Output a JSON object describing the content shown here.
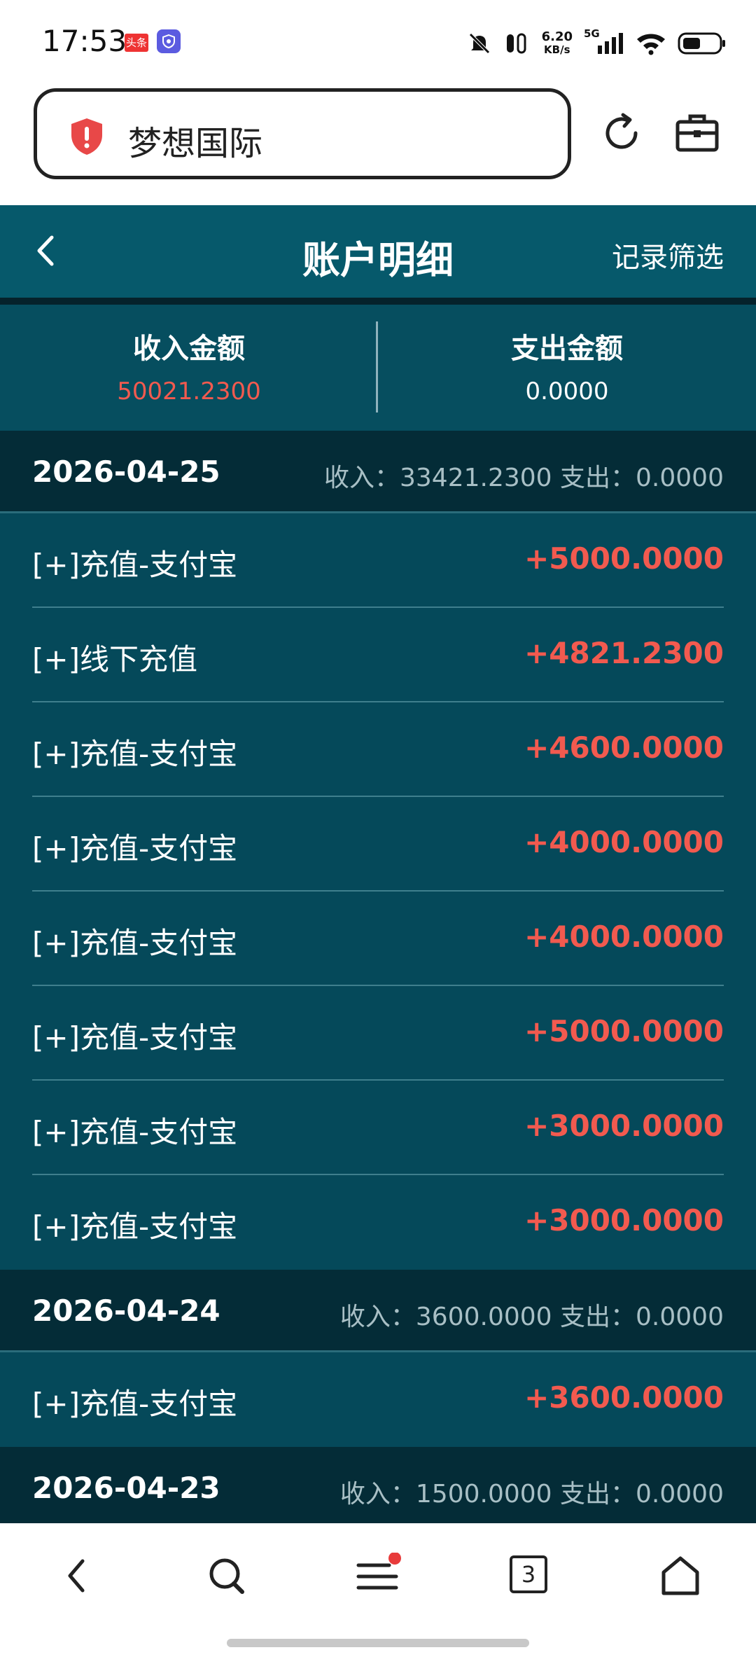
{
  "status_bar": {
    "time": "17:53",
    "badge_text": "头条",
    "net_speed_value": "6.20",
    "net_speed_unit": "KB/s",
    "network": "5G"
  },
  "browser": {
    "site_name": "梦想国际"
  },
  "header": {
    "title": "账户明细",
    "filter_label": "记录筛选"
  },
  "summary": {
    "income_label": "收入金额",
    "income_value": "50021.2300",
    "expense_label": "支出金额",
    "expense_value": "0.0000"
  },
  "days": [
    {
      "date": "2026-04-25",
      "summary": "收入：33421.2300 支出：0.0000",
      "items": [
        {
          "desc": "[+]充值-支付宝",
          "amount": "+5000.0000"
        },
        {
          "desc": "[+]线下充值",
          "amount": "+4821.2300"
        },
        {
          "desc": "[+]充值-支付宝",
          "amount": "+4600.0000"
        },
        {
          "desc": "[+]充值-支付宝",
          "amount": "+4000.0000"
        },
        {
          "desc": "[+]充值-支付宝",
          "amount": "+4000.0000"
        },
        {
          "desc": "[+]充值-支付宝",
          "amount": "+5000.0000"
        },
        {
          "desc": "[+]充值-支付宝",
          "amount": "+3000.0000"
        },
        {
          "desc": "[+]充值-支付宝",
          "amount": "+3000.0000"
        }
      ]
    },
    {
      "date": "2026-04-24",
      "summary": "收入：3600.0000 支出：0.0000",
      "items": [
        {
          "desc": "[+]充值-支付宝",
          "amount": "+3600.0000"
        }
      ]
    },
    {
      "date": "2026-04-23",
      "summary": "收入：1500.0000 支出：0.0000",
      "items": []
    }
  ],
  "nav": {
    "tab_count": "3"
  },
  "colors": {
    "header_bg": "#06596b",
    "list_bg": "#05495a",
    "day_header_bg": "#042c37",
    "amount_red": "#f25a4f"
  }
}
